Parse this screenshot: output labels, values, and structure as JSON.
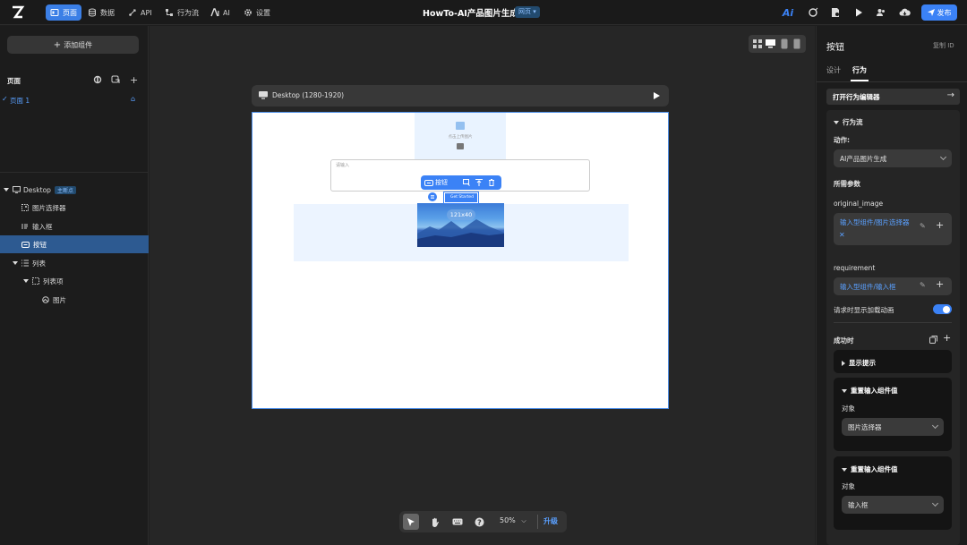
{
  "topbar": {
    "nav": [
      {
        "label": "页面",
        "icon": "page-icon",
        "active": true
      },
      {
        "label": "数据",
        "icon": "database-icon"
      },
      {
        "label": "API",
        "icon": "api-icon"
      },
      {
        "label": "行为流",
        "icon": "flow-icon"
      },
      {
        "label": "AI",
        "icon": "ai-icon"
      },
      {
        "label": "设置",
        "icon": "gear-icon"
      }
    ],
    "title": "HowTo-AI产品图片生成",
    "page_type": "网页",
    "publish_label": "发布",
    "accent": "#3b82f6"
  },
  "left": {
    "add_component": "添加组件",
    "pages_title": "页面",
    "page1": "页面 1",
    "tree": {
      "desktop": "Desktop",
      "badge": "主断点",
      "image_picker": "图片选择器",
      "input": "输入框",
      "button": "按钮",
      "list": "列表",
      "list_item": "列表项",
      "image": "图片"
    }
  },
  "canvas": {
    "frame_label": "Desktop (1280-1920)",
    "upload_label": "点击上传图片",
    "input_placeholder": "请输入",
    "selected_name": "按钮",
    "button_text": "Get Started",
    "size_readout": "121x40",
    "zoom": "50%",
    "upgrade": "升级"
  },
  "right": {
    "title": "按钮",
    "copy_id": "复制 ID",
    "tab_design": "设计",
    "tab_behavior": "行为",
    "open_editor": "打开行为编辑器",
    "flow_title": "行为流",
    "action_label": "动作:",
    "action_value": "AI产品图片生成",
    "params_label": "所需参数",
    "param1_name": "original_image",
    "param1_value": "输入型组件/图片选择器",
    "param2_name": "requirement",
    "param2_value": "输入型组件/输入框",
    "loading_label": "请求时显示加载动画",
    "loading_on": true,
    "on_success": "成功时",
    "show_tip": "显示提示",
    "reset_title1": "重置输入组件值",
    "target_label1": "对象",
    "target_value1": "图片选择器",
    "reset_title2": "重置输入组件值",
    "target_label2": "对象",
    "target_value2": "输入框"
  }
}
